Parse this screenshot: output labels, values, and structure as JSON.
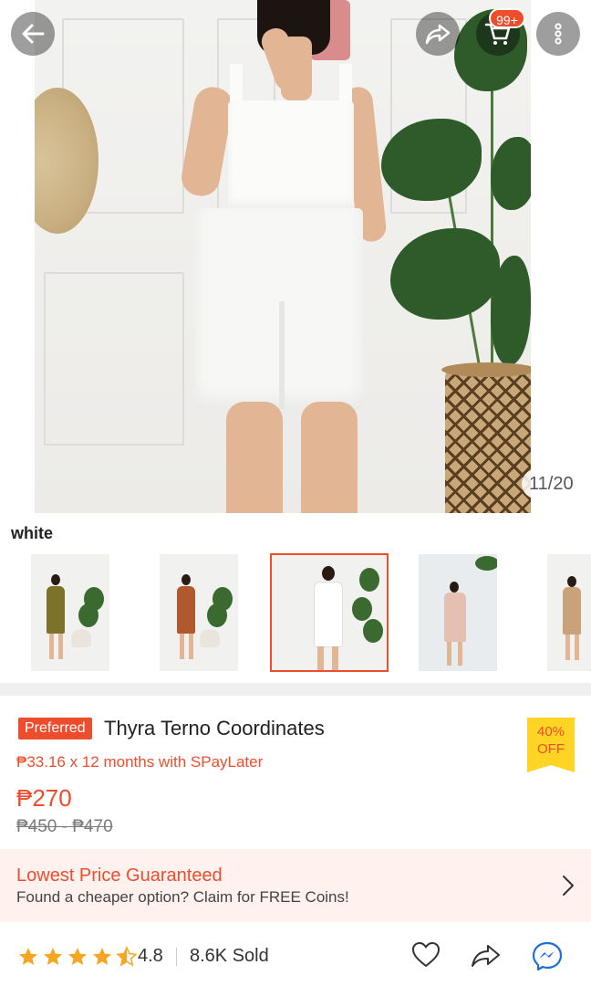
{
  "header": {
    "cart_count": "99+",
    "image_counter": "11/20"
  },
  "variation": {
    "selected_label": "white",
    "options": [
      {
        "name": "olive",
        "color": "#7d7328"
      },
      {
        "name": "rust",
        "color": "#b0582e"
      },
      {
        "name": "white",
        "color": "#f6f6f4"
      },
      {
        "name": "pink",
        "color": "#e4bfb2"
      },
      {
        "name": "beige",
        "color": "#c9a27a"
      }
    ]
  },
  "product": {
    "preferred_badge": "Preferred",
    "title": "Thyra Terno Coordinates",
    "discount_pct": "40%",
    "discount_word": "OFF",
    "installment": "₱33.16 x 12 months with SPayLater",
    "price": "₱270",
    "original_price": "₱450 - ₱470"
  },
  "guarantee": {
    "title": "Lowest Price Guaranteed",
    "subtitle": "Found a cheaper option? Claim for FREE Coins!"
  },
  "stats": {
    "rating": "4.8",
    "rating_value": 4.5,
    "sold": "8.6K Sold"
  },
  "colors": {
    "accent": "#ee4d2d",
    "star": "#f6a623",
    "discount_bg": "#ffd424"
  },
  "icons": {
    "back": "back-arrow-icon",
    "share": "share-icon",
    "cart": "cart-icon",
    "more": "more-icon",
    "favorite": "heart-icon",
    "chat": "messenger-chat-icon"
  }
}
